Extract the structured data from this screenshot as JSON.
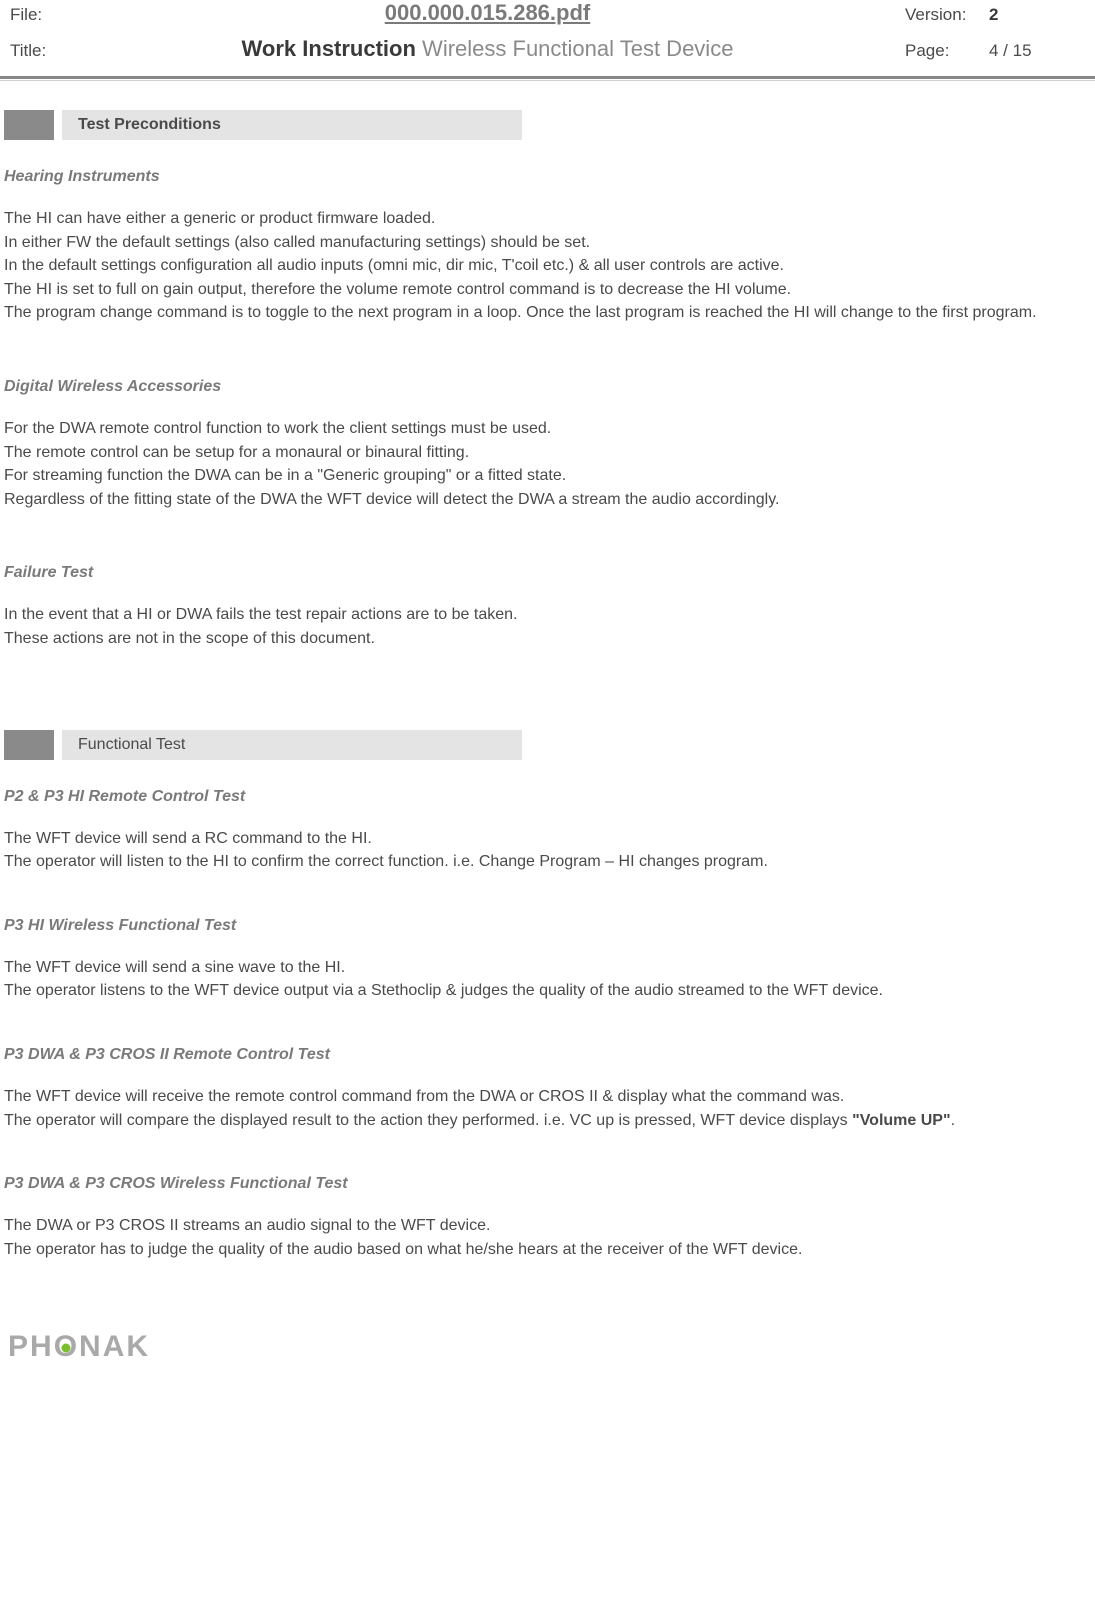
{
  "header": {
    "file_label": "File:",
    "file_value": "000.000.015.286.pdf",
    "title_label": "Title:",
    "title_bold": "Work Instruction",
    "title_rest": " Wireless Functional Test Device",
    "version_label": "Version:",
    "version_value": "2",
    "page_label": "Page:",
    "page_value": "4 / 15"
  },
  "section1": {
    "bar_label": "Test Preconditions",
    "sub1_title": "Hearing Instruments",
    "sub1_p1": "The HI can have either a generic or product firmware loaded.",
    "sub1_p2": "In either FW the default settings (also called manufacturing settings) should be set.",
    "sub1_p3": "In the default settings configuration all audio inputs (omni mic, dir mic, T'coil etc.) & all user controls are active.",
    "sub1_p4": "The HI is set to full on gain output, therefore the volume remote control command is to decrease the HI volume.",
    "sub1_p5": "The program change command is to toggle to the next program in a loop. Once the last program is reached the HI will change to the first program.",
    "sub2_title": "Digital Wireless Accessories",
    "sub2_p1": "For the DWA remote control function to work the client settings must be used.",
    "sub2_p2": "The remote control can be setup for a monaural or binaural fitting.",
    "sub2_p3": "For streaming function the DWA can be in a \"Generic grouping\" or a fitted state.",
    "sub2_p4": "Regardless of the fitting state of the DWA the WFT device will detect the DWA a stream the audio accordingly.",
    "sub3_title": "Failure Test",
    "sub3_p1": "In the event that a HI or DWA fails the test repair actions are to be taken.",
    "sub3_p2": "These actions are not in the scope of this document."
  },
  "section2": {
    "bar_label": "Functional Test",
    "sub1_title": "P2 & P3 HI  Remote Control Test",
    "sub1_p1": "The WFT device will send a RC command to the HI.",
    "sub1_p2": "The operator will listen to the HI to confirm the correct function. i.e. Change Program – HI changes program.",
    "sub2_title": "P3 HI Wireless Functional Test",
    "sub2_p1": "The WFT device will send a sine wave to the HI.",
    "sub2_p2": "The operator listens to the WFT device output via a Stethoclip & judges the quality of the audio streamed to the WFT device.",
    "sub3_title": "P3 DWA & P3 CROS II Remote Control Test",
    "sub3_p1": "The WFT device will receive the remote control command from the DWA or CROS II & display what the command was.",
    "sub3_p2a": "The operator will compare the displayed result to the action they performed.  i.e. VC up is pressed, WFT device displays ",
    "sub3_p2b": "\"Volume UP\"",
    "sub3_p2c": ".",
    "sub4_title": "P3 DWA & P3 CROS Wireless Functional Test",
    "sub4_p1": "The DWA or P3 CROS II streams an audio signal to the WFT device.",
    "sub4_p2": "The operator has to judge the quality of the audio based on what he/she hears at the receiver of the WFT device."
  },
  "footer": {
    "logo_part1": "PH",
    "logo_o": "O",
    "logo_part2": "NAK"
  }
}
